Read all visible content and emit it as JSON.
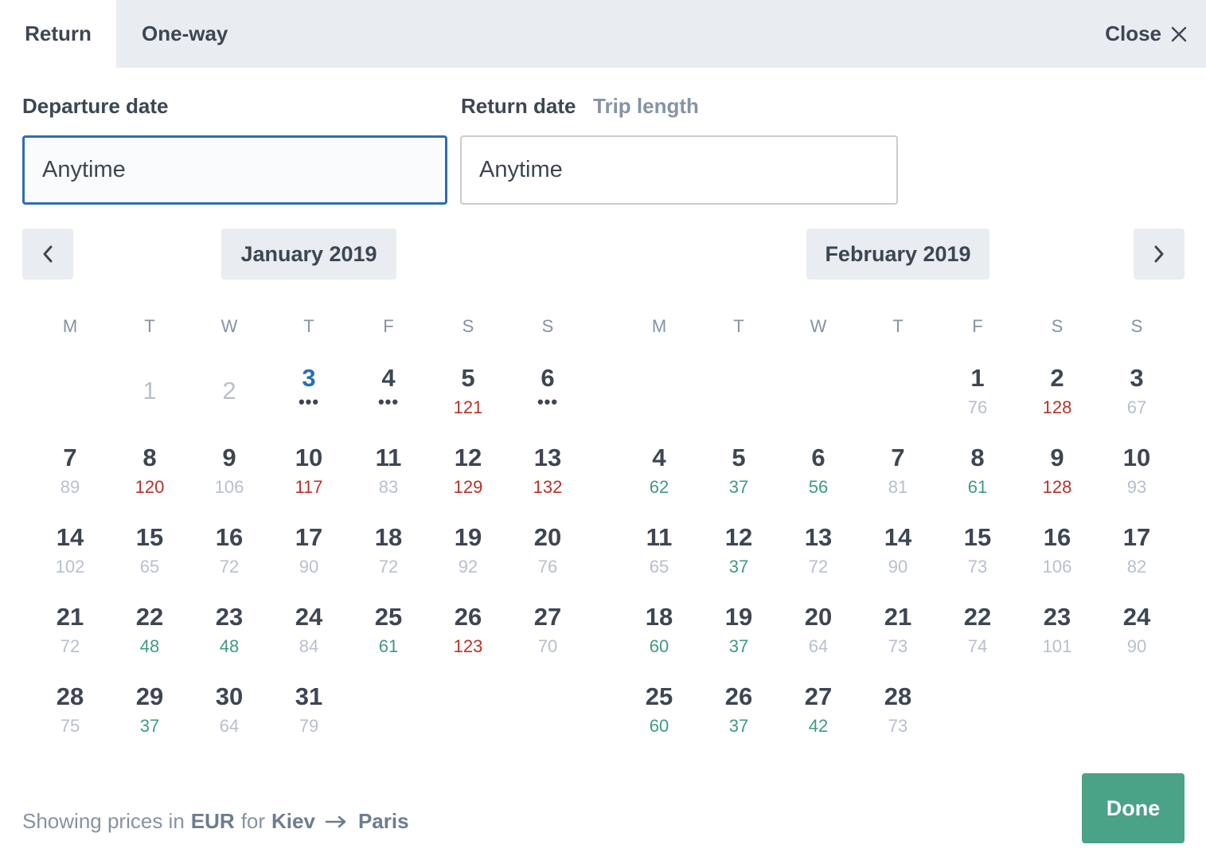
{
  "tabs": {
    "return": "Return",
    "one_way": "One-way"
  },
  "close": {
    "label": "Close"
  },
  "departure": {
    "label": "Departure date",
    "placeholder": "Anytime"
  },
  "return_date": {
    "label": "Return date",
    "trip_length": "Trip length",
    "placeholder": "Anytime"
  },
  "weekdays": [
    "M",
    "T",
    "W",
    "T",
    "F",
    "S",
    "S"
  ],
  "colors": {
    "accent": "#2d6db5",
    "low_price": "#3e9b7e",
    "high_price": "#b83228",
    "done": "#4aa287"
  },
  "months": [
    {
      "title": "January 2019",
      "offset": 1,
      "days": [
        {
          "d": "1",
          "p": "",
          "s": "past"
        },
        {
          "d": "2",
          "p": "",
          "s": "past"
        },
        {
          "d": "3",
          "p": "•••",
          "s": "today"
        },
        {
          "d": "4",
          "p": "•••",
          "s": "none"
        },
        {
          "d": "5",
          "p": "121",
          "s": "high"
        },
        {
          "d": "6",
          "p": "•••",
          "s": "none"
        },
        {
          "d": "7",
          "p": "89",
          "s": "normal"
        },
        {
          "d": "8",
          "p": "120",
          "s": "high"
        },
        {
          "d": "9",
          "p": "106",
          "s": "normal"
        },
        {
          "d": "10",
          "p": "117",
          "s": "high"
        },
        {
          "d": "11",
          "p": "83",
          "s": "normal"
        },
        {
          "d": "12",
          "p": "129",
          "s": "high"
        },
        {
          "d": "13",
          "p": "132",
          "s": "high"
        },
        {
          "d": "14",
          "p": "102",
          "s": "normal"
        },
        {
          "d": "15",
          "p": "65",
          "s": "normal"
        },
        {
          "d": "16",
          "p": "72",
          "s": "normal"
        },
        {
          "d": "17",
          "p": "90",
          "s": "normal"
        },
        {
          "d": "18",
          "p": "72",
          "s": "normal"
        },
        {
          "d": "19",
          "p": "92",
          "s": "normal"
        },
        {
          "d": "20",
          "p": "76",
          "s": "normal"
        },
        {
          "d": "21",
          "p": "72",
          "s": "normal"
        },
        {
          "d": "22",
          "p": "48",
          "s": "low"
        },
        {
          "d": "23",
          "p": "48",
          "s": "low"
        },
        {
          "d": "24",
          "p": "84",
          "s": "normal"
        },
        {
          "d": "25",
          "p": "61",
          "s": "low"
        },
        {
          "d": "26",
          "p": "123",
          "s": "high"
        },
        {
          "d": "27",
          "p": "70",
          "s": "normal"
        },
        {
          "d": "28",
          "p": "75",
          "s": "normal"
        },
        {
          "d": "29",
          "p": "37",
          "s": "low"
        },
        {
          "d": "30",
          "p": "64",
          "s": "normal"
        },
        {
          "d": "31",
          "p": "79",
          "s": "normal"
        }
      ]
    },
    {
      "title": "February 2019",
      "offset": 4,
      "days": [
        {
          "d": "1",
          "p": "76",
          "s": "normal"
        },
        {
          "d": "2",
          "p": "128",
          "s": "high"
        },
        {
          "d": "3",
          "p": "67",
          "s": "normal"
        },
        {
          "d": "4",
          "p": "62",
          "s": "low"
        },
        {
          "d": "5",
          "p": "37",
          "s": "low"
        },
        {
          "d": "6",
          "p": "56",
          "s": "low"
        },
        {
          "d": "7",
          "p": "81",
          "s": "normal"
        },
        {
          "d": "8",
          "p": "61",
          "s": "low"
        },
        {
          "d": "9",
          "p": "128",
          "s": "high"
        },
        {
          "d": "10",
          "p": "93",
          "s": "normal"
        },
        {
          "d": "11",
          "p": "65",
          "s": "normal"
        },
        {
          "d": "12",
          "p": "37",
          "s": "low"
        },
        {
          "d": "13",
          "p": "72",
          "s": "normal"
        },
        {
          "d": "14",
          "p": "90",
          "s": "normal"
        },
        {
          "d": "15",
          "p": "73",
          "s": "normal"
        },
        {
          "d": "16",
          "p": "106",
          "s": "normal"
        },
        {
          "d": "17",
          "p": "82",
          "s": "normal"
        },
        {
          "d": "18",
          "p": "60",
          "s": "low"
        },
        {
          "d": "19",
          "p": "37",
          "s": "low"
        },
        {
          "d": "20",
          "p": "64",
          "s": "normal"
        },
        {
          "d": "21",
          "p": "73",
          "s": "normal"
        },
        {
          "d": "22",
          "p": "74",
          "s": "normal"
        },
        {
          "d": "23",
          "p": "101",
          "s": "normal"
        },
        {
          "d": "24",
          "p": "90",
          "s": "normal"
        },
        {
          "d": "25",
          "p": "60",
          "s": "low"
        },
        {
          "d": "26",
          "p": "37",
          "s": "low"
        },
        {
          "d": "27",
          "p": "42",
          "s": "low"
        },
        {
          "d": "28",
          "p": "73",
          "s": "normal"
        }
      ]
    }
  ],
  "footer": {
    "prefix": "Showing prices in",
    "currency": "EUR",
    "for": "for",
    "origin": "Kiev",
    "destination": "Paris"
  },
  "done": {
    "label": "Done"
  }
}
